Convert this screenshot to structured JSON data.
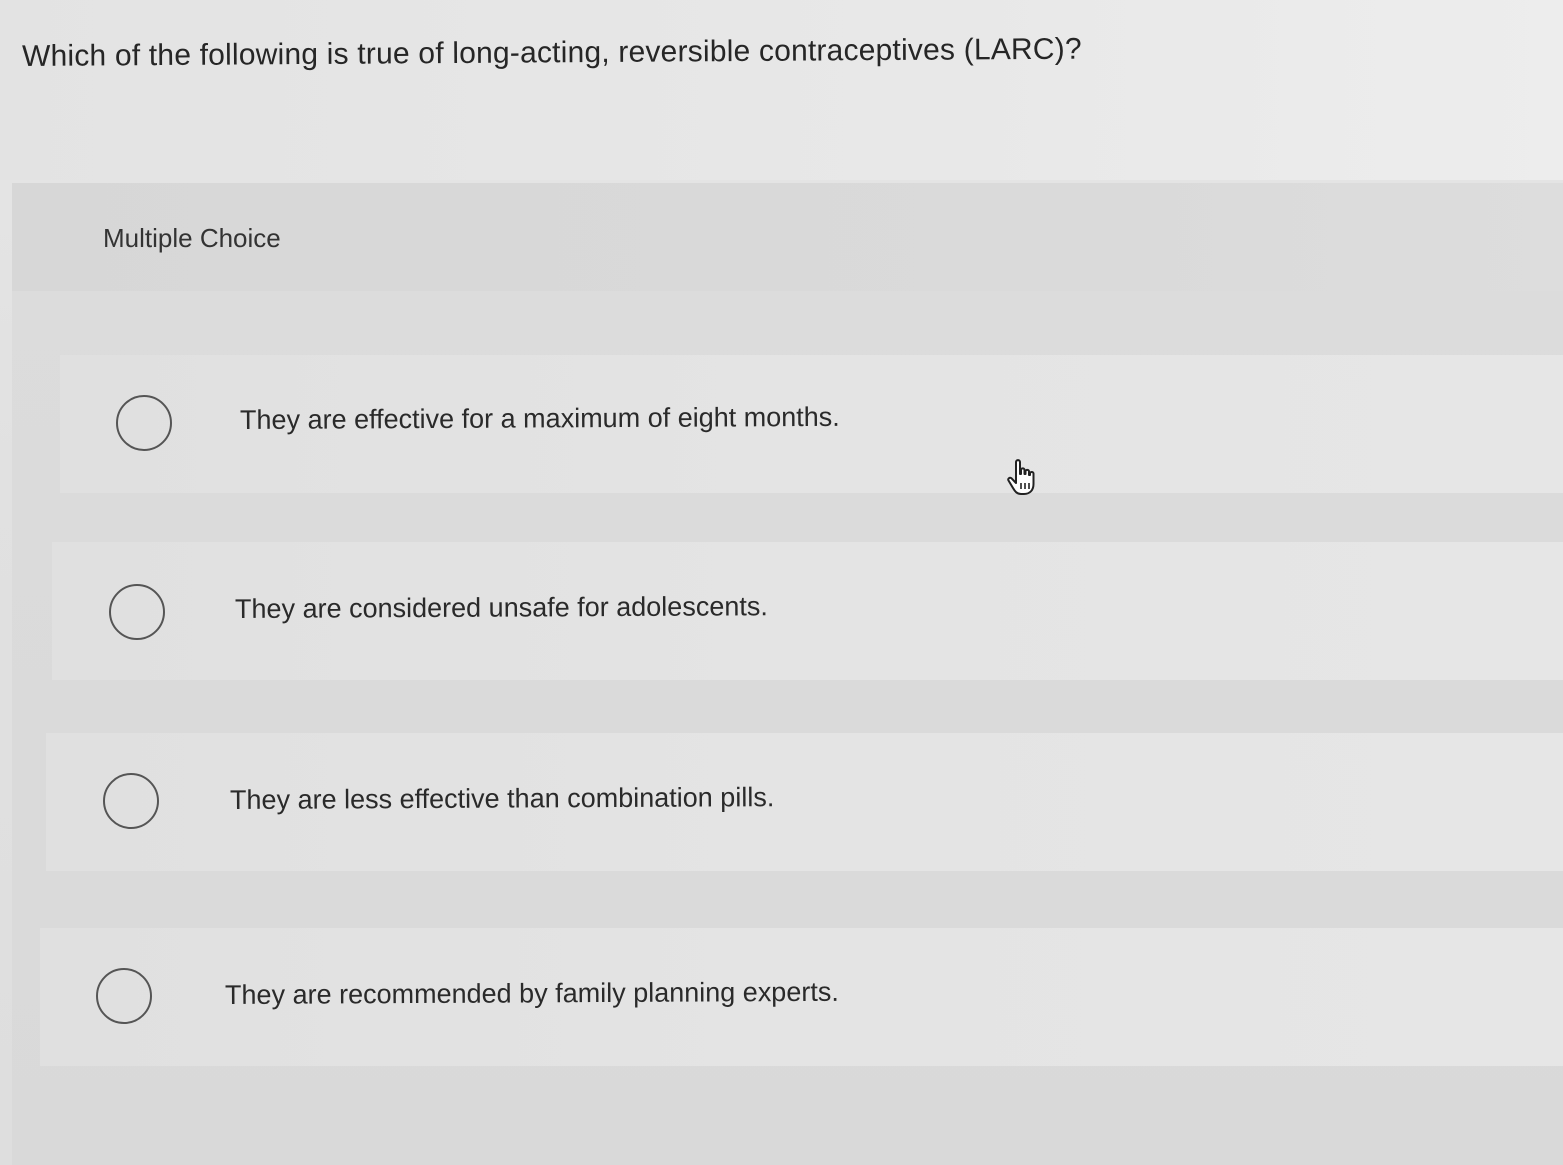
{
  "question": {
    "text": "Which of the following is true of long-acting, reversible contraceptives (LARC)?"
  },
  "multiple_choice": {
    "label": "Multiple Choice",
    "options": [
      {
        "text": "They are effective for a maximum of eight months.",
        "selected": false
      },
      {
        "text": "They are considered unsafe for adolescents.",
        "selected": false
      },
      {
        "text": "They are less effective than combination pills.",
        "selected": false
      },
      {
        "text": "They are recommended by family planning experts.",
        "selected": false
      }
    ]
  },
  "cursor": {
    "icon": "hand-pointer-icon"
  }
}
